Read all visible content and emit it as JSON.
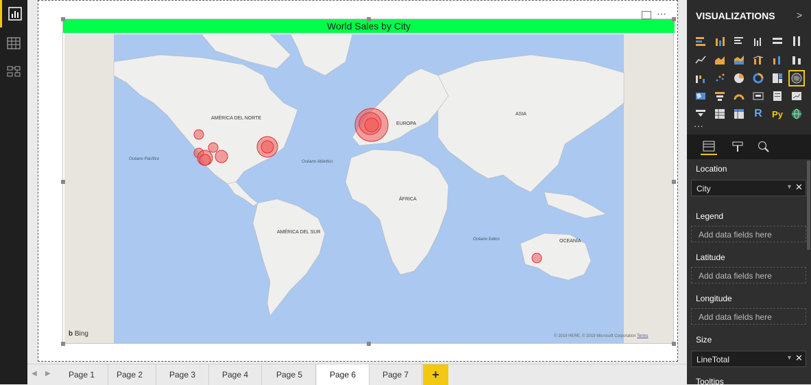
{
  "visual": {
    "title": "World Sales by City",
    "title_color": "#00ff4a",
    "map": {
      "labels": [
        "AMÉRICA DEL NORTE",
        "EUROPA",
        "ASIA",
        "ÁFRICA",
        "AMÉRICA DEL SUR",
        "OCEANÍA"
      ],
      "oceans": [
        "Océano Pacífico",
        "Océano Atlántico",
        "Océano Índico"
      ],
      "bubble_color": "#f15a5a",
      "provider": "Bing",
      "copyright": "© 2019 HERE, © 2019 Microsoft Corporation",
      "terms": "Terms"
    }
  },
  "tabs": [
    "Page 1",
    "Page 2",
    "Page 3",
    "Page 4",
    "Page 5",
    "Page 6",
    "Page 7"
  ],
  "active_tab": "Page 6",
  "add_tab_label": "+",
  "panel": {
    "header": "VISUALIZATIONS",
    "more": "...",
    "accent": "#f2c811",
    "wells": {
      "location_label": "Location",
      "location_value": "City",
      "legend_label": "Legend",
      "legend_placeholder": "Add data fields here",
      "latitude_label": "Latitude",
      "latitude_placeholder": "Add data fields here",
      "longitude_label": "Longitude",
      "longitude_placeholder": "Add data fields here",
      "size_label": "Size",
      "size_value": "LineTotal",
      "tooltips_label": "Tooltips"
    }
  }
}
